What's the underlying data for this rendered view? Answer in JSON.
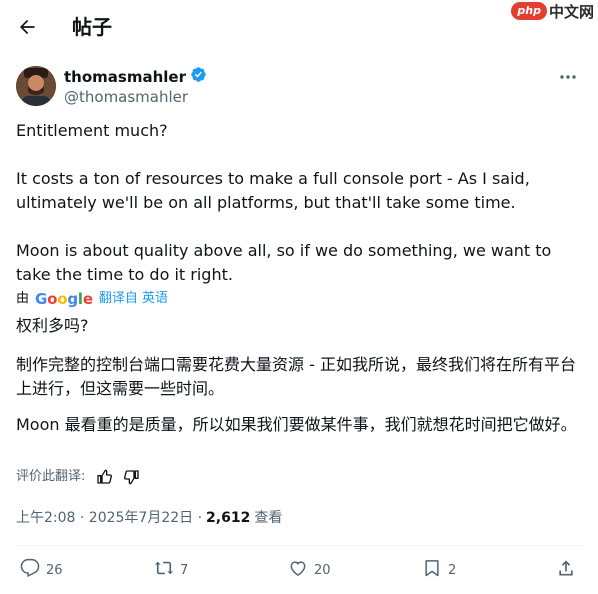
{
  "header": {
    "title": "帖子"
  },
  "watermark": {
    "brand": "php",
    "text": "中文网"
  },
  "post": {
    "display_name": "thomasmahler",
    "handle": "@thomasmahler",
    "original": [
      "Entitlement much?",
      "It costs a ton of resources to make a full console port - As I said, ultimately we'll be on all platforms, but that'll take some time.",
      "Moon is about quality above all, so if we do something, we want to take the time to do it right."
    ],
    "translation_by": "由",
    "translation_provider": "Google",
    "translate_link": "翻译自 英语",
    "translated": [
      "权利多吗?",
      "制作完整的控制台端口需要花费大量资源 - 正如我所说，最终我们将在所有平台上进行，但这需要一些时间。",
      "Moon 最看重的是质量，所以如果我们要做某件事，我们就想花时间把它做好。"
    ],
    "rate_label": "评价此翻译:",
    "timestamp": "上午2:08 · 2025年7月22日 ·",
    "views_count": "2,612",
    "views_label": "查看"
  },
  "actions": {
    "replies": "26",
    "reposts": "7",
    "likes": "20",
    "bookmarks": "2"
  },
  "colors": {
    "accent": "#1d9bf0",
    "muted": "#536471",
    "verified": "#1d9bf0"
  }
}
